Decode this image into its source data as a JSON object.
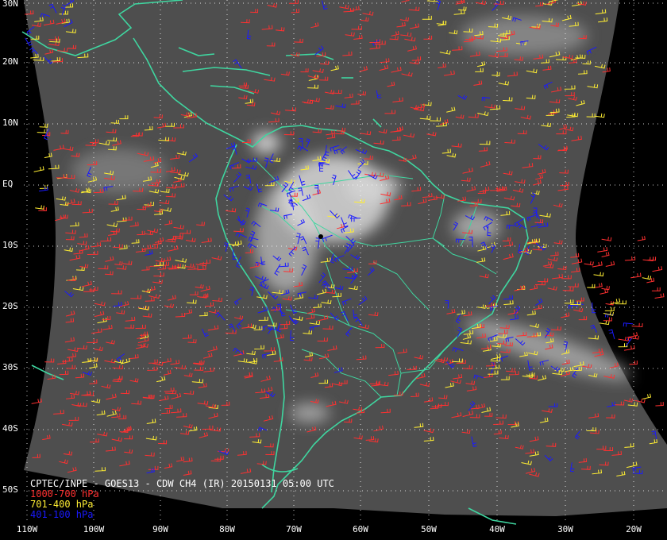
{
  "header": {
    "title": "CPTEC/INPE - GOES13 - CDW CH4 (IR) 20150131 05:00 UTC"
  },
  "legend": [
    {
      "label": "1000-700 hPa",
      "color": "#ff3030"
    },
    {
      "label": "701-400 hPa",
      "color": "#ffee33"
    },
    {
      "label": "401-100 hPa",
      "color": "#1a1aff"
    }
  ],
  "grid": {
    "latitudes": [
      "30N",
      "20N",
      "10N",
      "EQ",
      "10S",
      "20S",
      "30S",
      "40S",
      "50S"
    ],
    "longitudes": [
      "110W",
      "100W",
      "90W",
      "80W",
      "70W",
      "60W",
      "50W",
      "40W",
      "30W",
      "20W"
    ]
  },
  "colors": {
    "background": "#000000",
    "coastline": "#3fd6a0",
    "gridline": "#ffffff",
    "satellite_base": "#4e4e4e"
  }
}
